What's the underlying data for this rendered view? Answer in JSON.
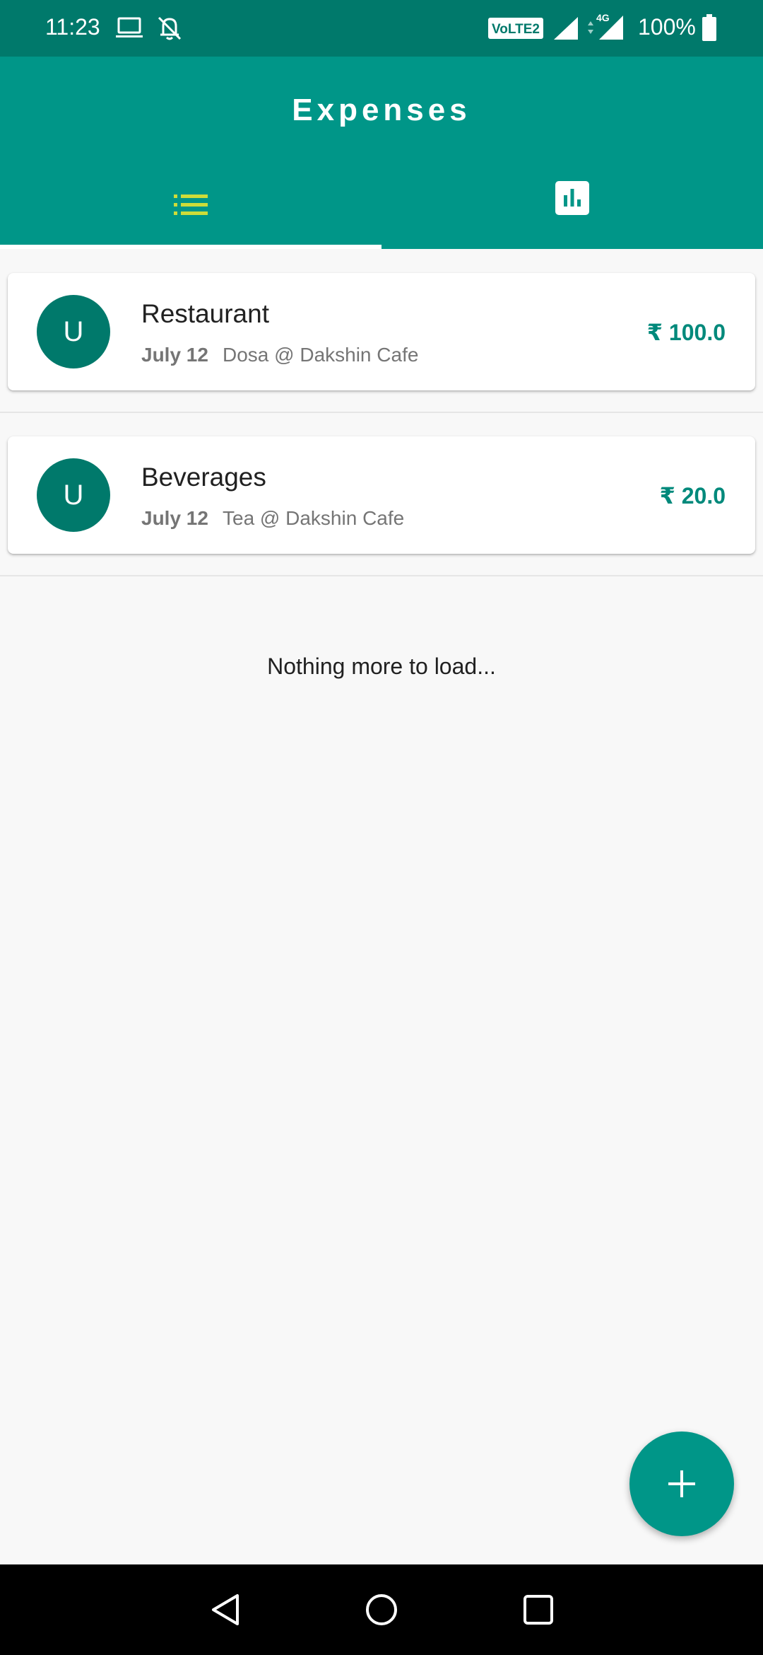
{
  "status_bar": {
    "time": "11:23",
    "volte_label": "VoLTE2",
    "network_type": "4G",
    "battery_percent": "100%",
    "icons": [
      "laptop-icon",
      "notifications-off-icon",
      "volte-icon",
      "signal-icon",
      "signal-4g-icon",
      "battery-icon"
    ]
  },
  "app_bar": {
    "title": "Expenses",
    "tabs": [
      {
        "icon": "list-icon",
        "selected": true
      },
      {
        "icon": "bar-chart-icon",
        "selected": false
      }
    ]
  },
  "expenses": [
    {
      "avatar": "U",
      "category": "Restaurant",
      "date": "July 12",
      "note": "Dosa @ Dakshin Cafe",
      "amount": "₹ 100.0"
    },
    {
      "avatar": "U",
      "category": "Beverages",
      "date": "July 12",
      "note": "Tea @ Dakshin Cafe",
      "amount": "₹ 20.0"
    }
  ],
  "list_end_text": "Nothing more to load...",
  "fab": {
    "icon": "plus-icon"
  },
  "nav_bar": {
    "icons": [
      "back-icon",
      "home-icon",
      "recents-icon"
    ]
  },
  "colors": {
    "status_bar": "#00796b",
    "primary": "#009688",
    "avatar": "#00796b",
    "amount": "#00897b",
    "selected_tab_icon": "#cddc39",
    "background": "#f8f8f8"
  }
}
